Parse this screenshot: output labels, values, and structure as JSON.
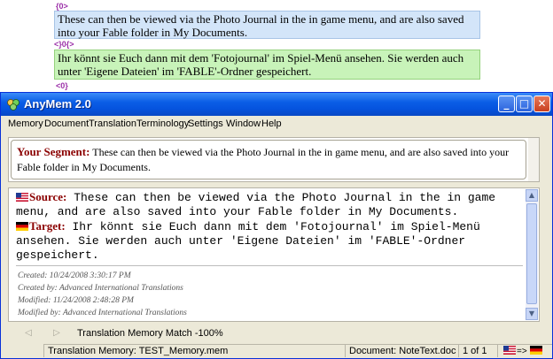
{
  "document": {
    "tag_en": "{0>",
    "segment_en": "These can then be viewed via the Photo Journal in the in game menu, and are also saved into your Fable folder in My Documents.",
    "tag_de": "<}0{>",
    "segment_de": "Ihr könnt sie Euch dann mit dem 'Fotojournal' im Spiel-Menü ansehen. Sie werden auch unter 'Eigene Dateien' im 'FABLE'-Ordner gespeichert.",
    "tag_end": "<0}"
  },
  "window": {
    "title": "AnyMem 2.0",
    "buttons": {
      "minimize": "_",
      "maximize": "□",
      "close": "✕"
    }
  },
  "menu": [
    "Memory",
    "Document",
    "Translation",
    "Terminology",
    "Settings",
    "Window",
    "Help"
  ],
  "your_segment": {
    "label": "Your Segment:",
    "text": "These can then be viewed via the Photo Journal in the in game menu, and are also saved into your Fable folder in My Documents."
  },
  "match": {
    "source_label": "Source:",
    "source_text": "These can then be viewed via the Photo Journal in the in game menu, and are also saved into your Fable folder in My Documents.",
    "target_label": "Target:",
    "target_text": "Ihr könnt sie Euch dann mit dem 'Fotojournal' im Spiel-Menü ansehen. Sie werden auch unter 'Eigene Dateien' im 'FABLE'-Ordner gespeichert.",
    "created": "Created: 10/24/2008 3:30:17 PM",
    "created_by": "Created by: Advanced International Translations",
    "modified": "Modified: 11/24/2008 2:48:28 PM",
    "modified_by": "Modified by: Advanced International Translations"
  },
  "nav": {
    "prev": "◁",
    "next": "▷",
    "match_info": "Translation Memory Match -100%"
  },
  "status": {
    "memory": "Translation Memory: TEST_Memory.mem",
    "document": "Document: NoteText.doc",
    "page": "1 of 1",
    "direction_arrow": "=>"
  },
  "icons": {
    "source_flag": "us-flag-icon",
    "target_flag": "german-flag-icon",
    "app": "anymem-app-icon"
  },
  "colors": {
    "title_bar": "#0b5ee6",
    "label_red": "#8b0000",
    "segment_en_bg": "#d3e5f9",
    "segment_de_bg": "#c8f3b9",
    "tag_purple": "#9b2fa8"
  }
}
